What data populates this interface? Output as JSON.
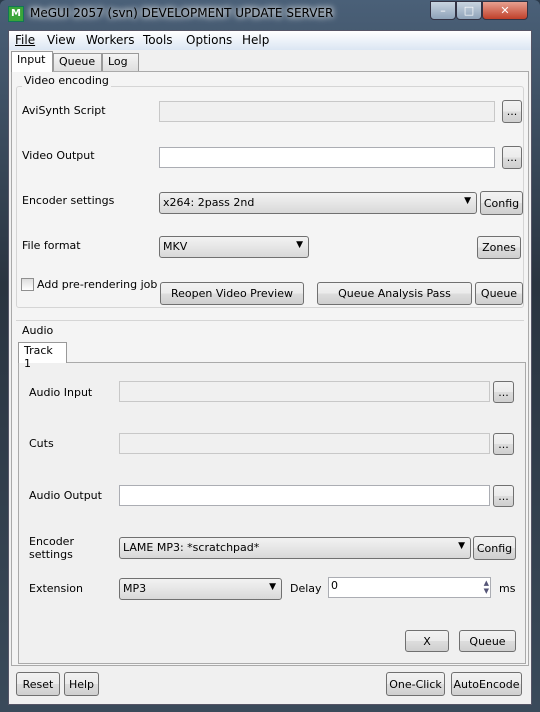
{
  "window": {
    "title": "MeGUI 2057 (svn) DEVELOPMENT UPDATE SERVER",
    "icon_text": "M",
    "minimize": "–",
    "maximize": "□",
    "close": "✕"
  },
  "menu": [
    "File",
    "View",
    "Workers",
    "Tools",
    "Options",
    "Help"
  ],
  "tabs": [
    "Input",
    "Queue",
    "Log"
  ],
  "video": {
    "group": "Video encoding",
    "avisynth_label": "AviSynth Script",
    "avisynth_value": "",
    "video_output_label": "Video Output",
    "video_output_value": "",
    "encoder_label": "Encoder settings",
    "encoder_value": "x264: 2pass 2nd",
    "config": "Config",
    "file_format_label": "File format",
    "file_format_value": "MKV",
    "zones": "Zones",
    "prerender_label": "Add pre-rendering job",
    "prerender_checked": false,
    "reopen": "Reopen Video Preview",
    "queue_analysis": "Queue Analysis Pass",
    "queue": "Queue",
    "browse": "..."
  },
  "audio": {
    "group": "Audio",
    "track_tab": "Track 1",
    "input_label": "Audio Input",
    "cuts_label": "Cuts",
    "output_label": "Audio Output",
    "encoder_label_1": "Encoder",
    "encoder_label_2": "settings",
    "encoder_value": "LAME MP3: *scratchpad*",
    "config": "Config",
    "extension_label": "Extension",
    "extension_value": "MP3",
    "delay_label": "Delay",
    "delay_value": "0",
    "ms": "ms",
    "x": "X",
    "queue": "Queue",
    "browse": "..."
  },
  "bottom": {
    "reset": "Reset",
    "help": "Help",
    "one_click": "One-Click",
    "autoencode": "AutoEncode"
  }
}
